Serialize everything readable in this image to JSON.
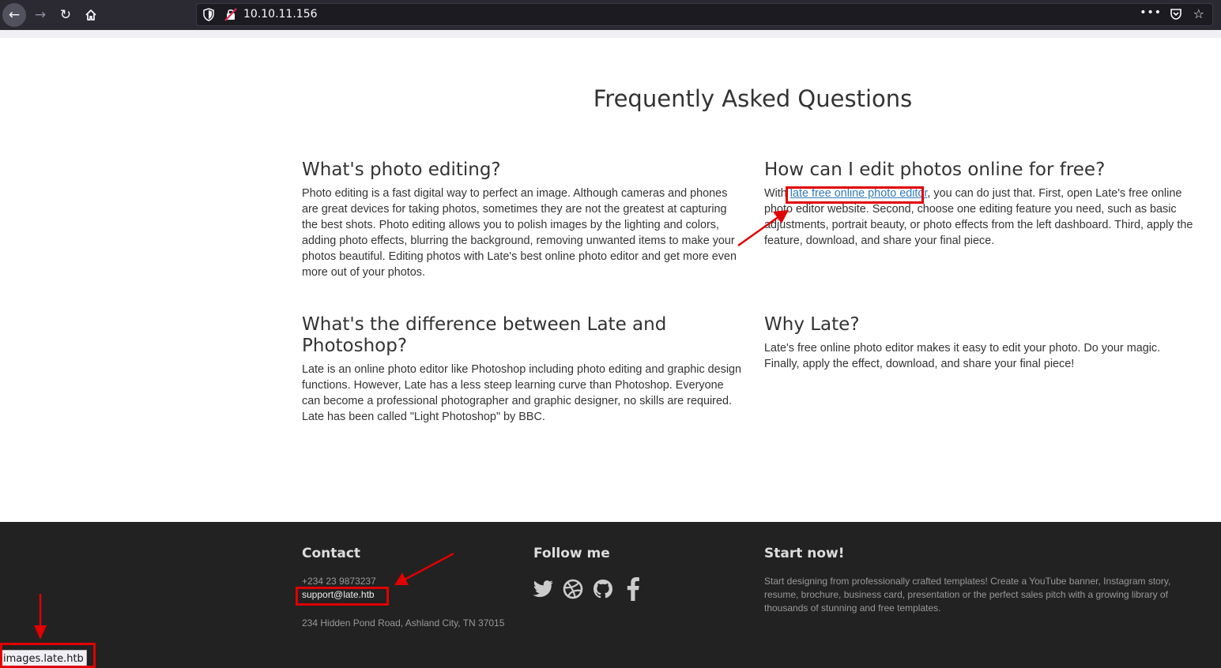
{
  "browser": {
    "url": "10.10.11.156",
    "more_glyph": "•••",
    "status_url": "images.late.htb",
    "icons": {
      "back": "back-arrow-icon",
      "forward": "forward-arrow-icon",
      "reload": "reload-icon",
      "home": "home-icon",
      "shield": "tracking-protection-shield-icon",
      "insecure": "insecure-lock-icon",
      "pocket": "pocket-icon",
      "bookmark": "bookmark-star-icon"
    }
  },
  "faq": {
    "title": "Frequently Asked Questions",
    "items": [
      {
        "question": "What's photo editing?",
        "answer": "Photo editing is a fast digital way to perfect an image. Although cameras and phones are great devices for taking photos, sometimes they are not the greatest at capturing the best shots. Photo editing allows you to polish images by the lighting and colors, adding photo effects, blurring the background, removing unwanted items to make your photos beautiful. Editing photos with Late's best online photo editor and get more even more out of your photos."
      },
      {
        "question": "How can I edit photos online for free?",
        "answer_prefix": "With ",
        "answer_link": "late free online photo editor",
        "answer_suffix": ", you can do just that. First, open Late's free online photo editor website. Second, choose one editing feature you need, such as basic adjustments, portrait beauty, or photo effects from the left dashboard. Third, apply the feature, download, and share your final piece."
      },
      {
        "question": "What's the difference between Late and Photoshop?",
        "answer": "Late is an online photo editor like Photoshop including photo editing and graphic design functions. However, Late has a less steep learning curve than Photoshop. Everyone can become a professional photographer and graphic designer, no skills are required. Late has been called \"Light Photoshop\" by BBC."
      },
      {
        "question": "Why Late?",
        "answer": "Late's free online photo editor makes it easy to edit your photo. Do your magic. Finally, apply the effect, download, and share your final piece!"
      }
    ]
  },
  "footer": {
    "contact": {
      "heading": "Contact",
      "phone": "+234 23 9873237",
      "email": "support@late.htb",
      "address": "234 Hidden Pond Road, Ashland City, TN 37015"
    },
    "follow": {
      "heading": "Follow me",
      "icons": [
        "twitter-icon",
        "dribbble-icon",
        "github-icon",
        "facebook-icon"
      ]
    },
    "start": {
      "heading": "Start now!",
      "text": "Start designing from professionally crafted templates! Create a YouTube banner, Instagram story, resume, brochure, business card, presentation or the perfect sales pitch with a growing library of thousands of stunning and free templates."
    }
  },
  "annotations": {
    "color": "#e00000"
  }
}
